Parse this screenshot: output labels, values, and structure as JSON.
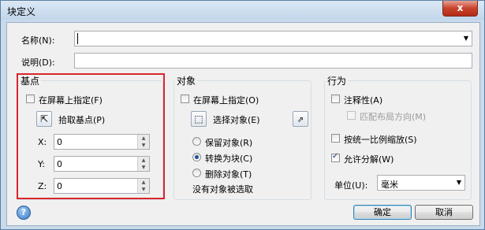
{
  "window": {
    "title": "块定义",
    "close_glyph": "x"
  },
  "name": {
    "label": "名称(N):",
    "value": ""
  },
  "description": {
    "label": "说明(D):",
    "value": ""
  },
  "base_point": {
    "group_label": "基点",
    "specify_on_screen": {
      "label": "在屏幕上指定(F)",
      "checked": false
    },
    "pick_button": {
      "label": "拾取基点(P)",
      "icon": "pick-point-icon"
    },
    "x": {
      "label": "X:",
      "value": "0"
    },
    "y": {
      "label": "Y:",
      "value": "0"
    },
    "z": {
      "label": "Z:",
      "value": "0"
    }
  },
  "objects": {
    "group_label": "对象",
    "specify_on_screen": {
      "label": "在屏幕上指定(O)",
      "checked": false
    },
    "select_button": {
      "label": "选择对象(E)",
      "icon": "select-objects-icon"
    },
    "quick_select_icon": "quick-select-icon",
    "options": [
      {
        "label": "保留对象(R)",
        "selected": false
      },
      {
        "label": "转换为块(C)",
        "selected": true
      },
      {
        "label": "删除对象(T)",
        "selected": false
      }
    ],
    "status": "没有对象被选取"
  },
  "behavior": {
    "group_label": "行为",
    "annotative": {
      "label": "注释性(A)",
      "checked": false
    },
    "match_orientation": {
      "label": "匹配布局方向(M)",
      "checked": false,
      "disabled": true
    },
    "scale_uniformly": {
      "label": "按统一比例缩放(S)",
      "checked": false
    },
    "allow_explode": {
      "label": "允许分解(W)",
      "checked": true
    },
    "unit": {
      "label": "单位(U):",
      "value": "毫米"
    }
  },
  "buttons": {
    "ok": "确定",
    "cancel": "取消",
    "help": "?"
  },
  "colors": {
    "highlight_box": "#d9262c"
  }
}
